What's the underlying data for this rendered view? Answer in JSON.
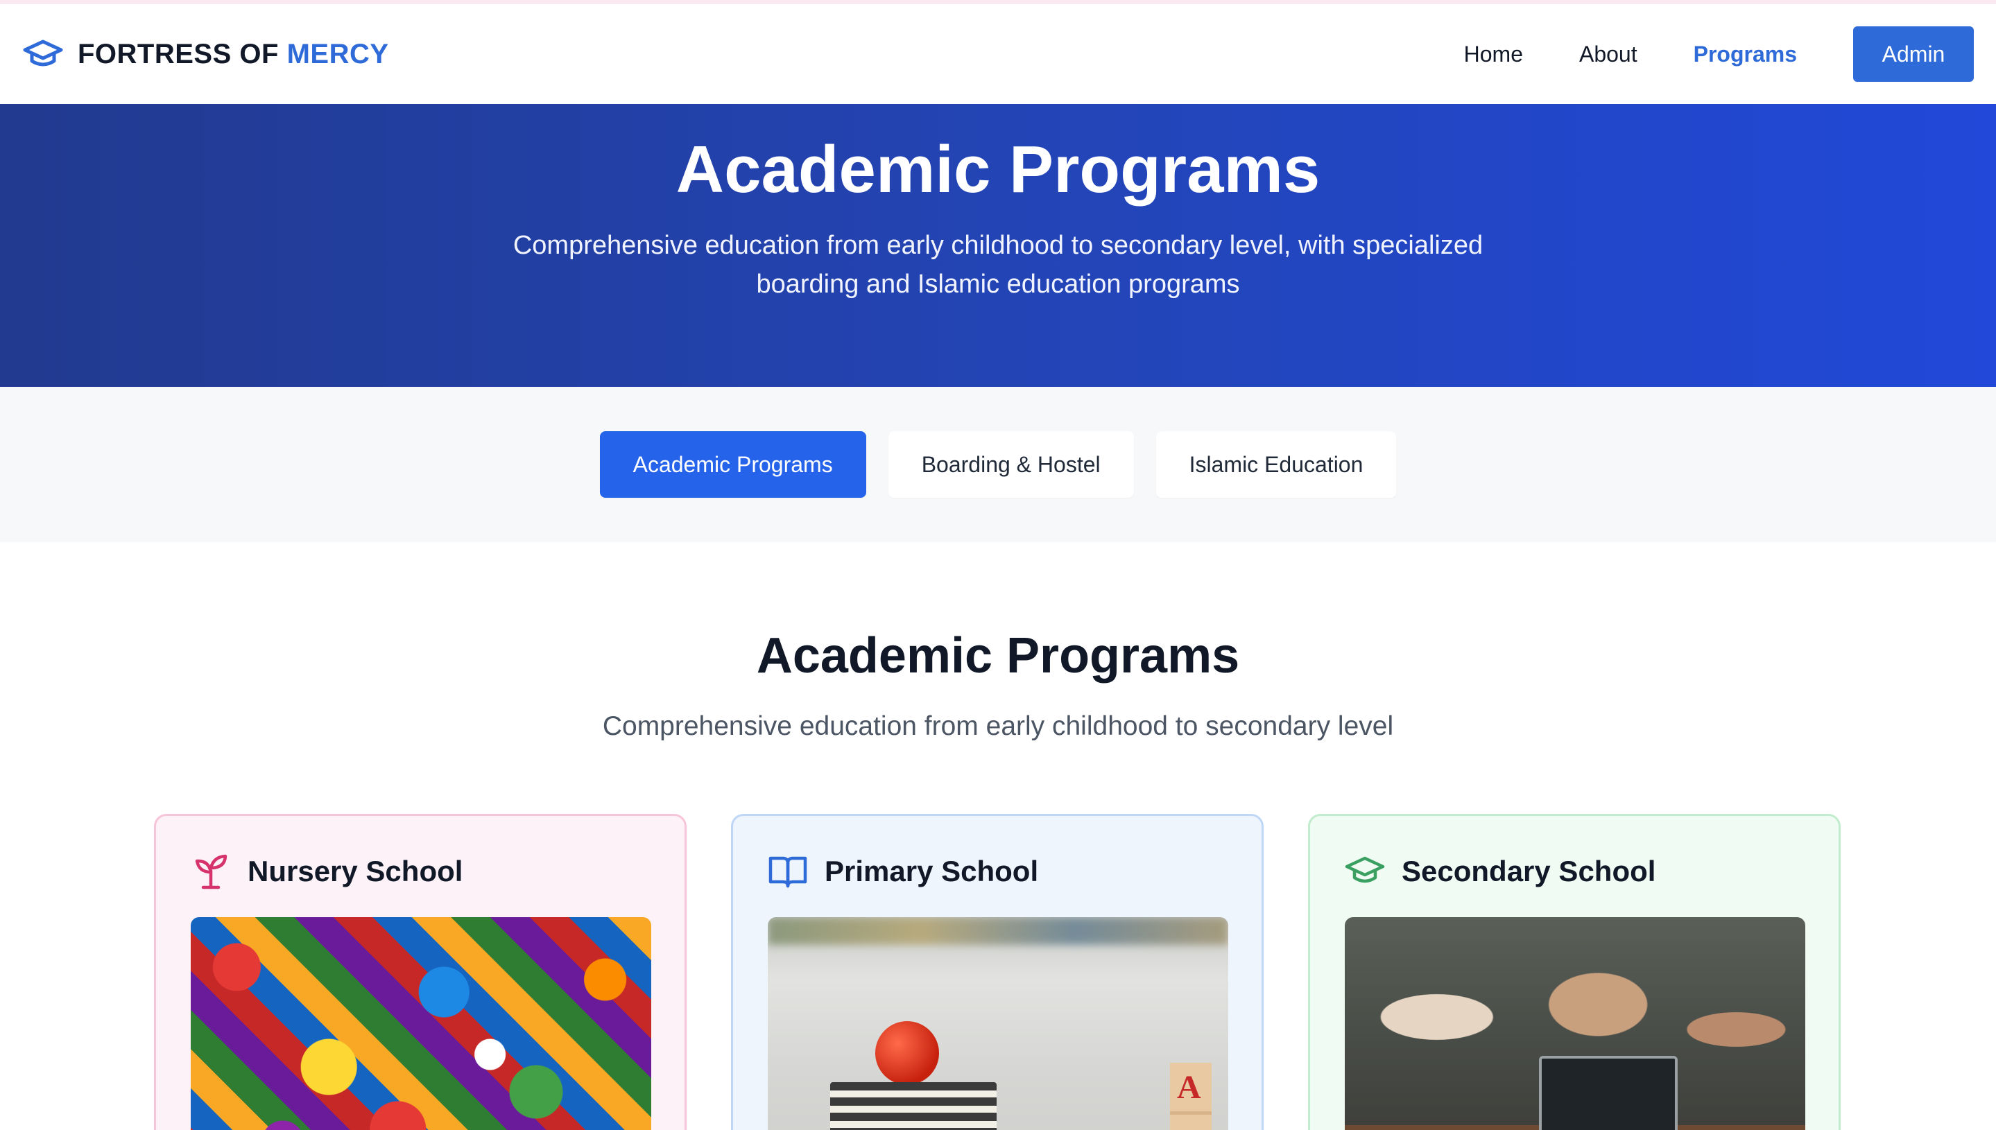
{
  "brand": {
    "name_part1": "FORTRESS OF",
    "name_part2": "MERCY",
    "logo_icon": "graduation-cap-icon",
    "accent_color": "#2f6bd8"
  },
  "nav": {
    "links": [
      {
        "label": "Home",
        "active": false
      },
      {
        "label": "About",
        "active": false
      },
      {
        "label": "Programs",
        "active": true
      }
    ],
    "admin_label": "Admin"
  },
  "hero": {
    "title": "Academic Programs",
    "subtitle": "Comprehensive education from early childhood to secondary level, with specialized boarding and Islamic education programs"
  },
  "tabs": [
    {
      "label": "Academic Programs",
      "active": true
    },
    {
      "label": "Boarding & Hostel",
      "active": false
    },
    {
      "label": "Islamic Education",
      "active": false
    }
  ],
  "section": {
    "title": "Academic Programs",
    "subtitle": "Comprehensive education from early childhood to secondary level"
  },
  "cards": [
    {
      "title": "Nursery School",
      "icon": "sprout-icon",
      "accent": "#d6336c"
    },
    {
      "title": "Primary School",
      "icon": "open-book-icon",
      "accent": "#2f6bd8"
    },
    {
      "title": "Secondary School",
      "icon": "graduation-cap-icon",
      "accent": "#3aa061"
    }
  ]
}
